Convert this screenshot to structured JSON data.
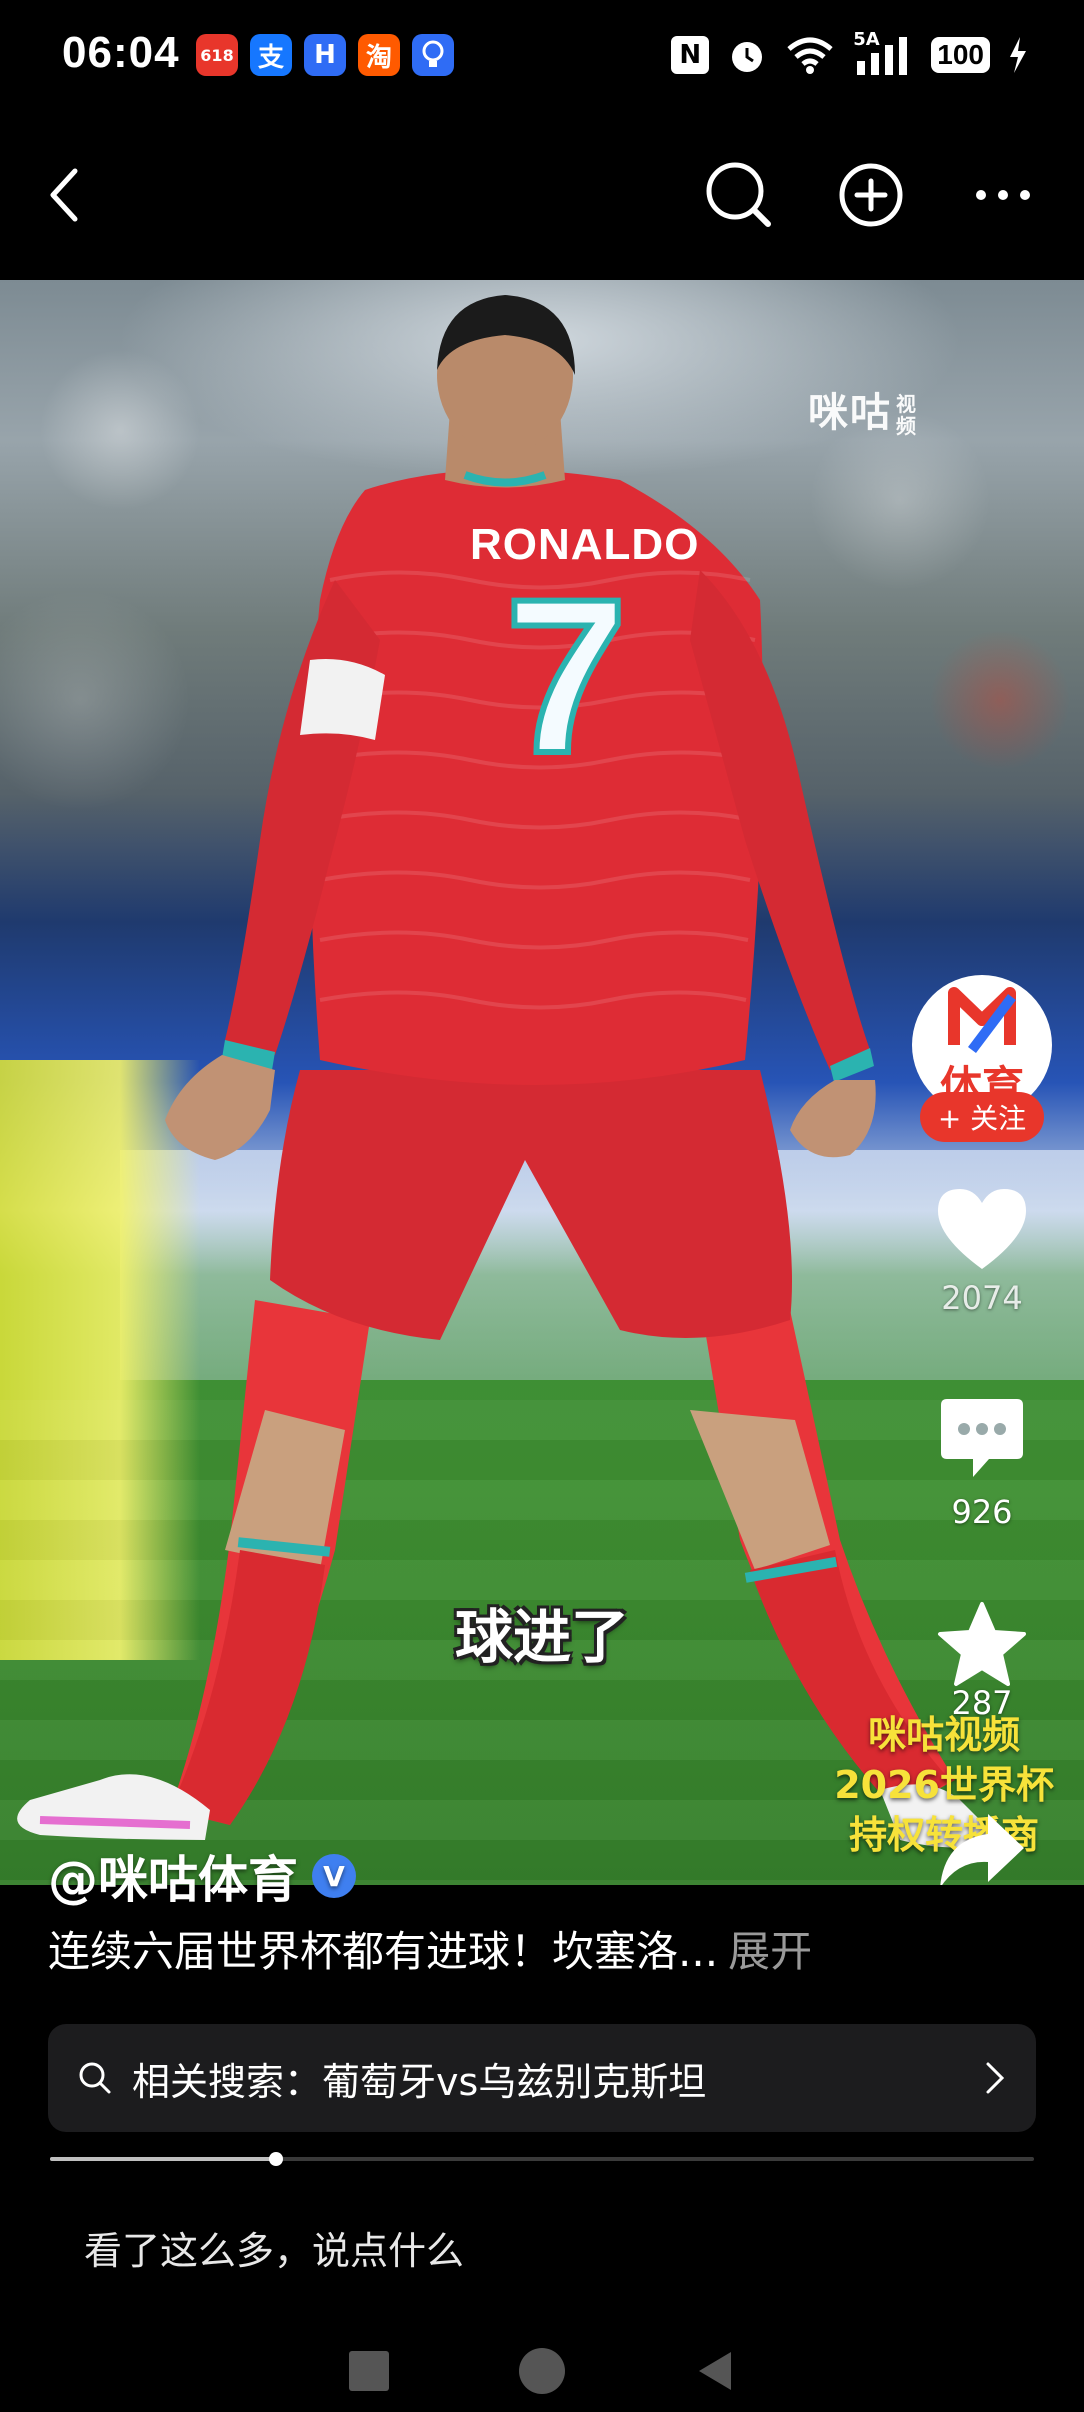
{
  "status_bar": {
    "time": "06:04",
    "app_badges": [
      {
        "icon": "taobao-618-icon",
        "label": "618",
        "color": "#e8362b"
      },
      {
        "icon": "alipay-icon",
        "label": "支",
        "color": "#1677ff"
      },
      {
        "icon": "app-h-icon",
        "label": "H",
        "color": "#2f6cf5"
      },
      {
        "icon": "taobao-icon",
        "label": "淘",
        "color": "#ff5a00"
      },
      {
        "icon": "bulb-icon",
        "label": "",
        "color": "#2f6cf5"
      }
    ],
    "nfc_label": "N",
    "network_label": "5A",
    "battery": "100"
  },
  "nav": {
    "back_icon": "chevron-left-icon",
    "search_icon": "search-icon",
    "add_icon": "plus-circle-icon",
    "more_icon": "more-icon"
  },
  "video": {
    "watermark": "咪咕",
    "watermark_sub": "视频",
    "jersey_name": "RONALDO",
    "jersey_number": "7",
    "subtitle": "球进了",
    "promo_lines": [
      "咪咕视频",
      "2026世界杯",
      "持权转播商"
    ]
  },
  "actions": {
    "avatar_text": "体育",
    "follow": "+ 关注",
    "like_count": "2074",
    "comment_count": "926",
    "favorite_count": "287",
    "share_label": "分享"
  },
  "info": {
    "author": "@咪咕体育",
    "verified": "V",
    "description": "连续六届世界杯都有进球！坎塞洛...",
    "expand": "展开"
  },
  "related_search": {
    "label": "相关搜索：葡萄牙vs乌兹别克斯坦"
  },
  "progress": {
    "fraction": 0.23
  },
  "comment_box": {
    "placeholder": "看了这么多，说点什么"
  }
}
